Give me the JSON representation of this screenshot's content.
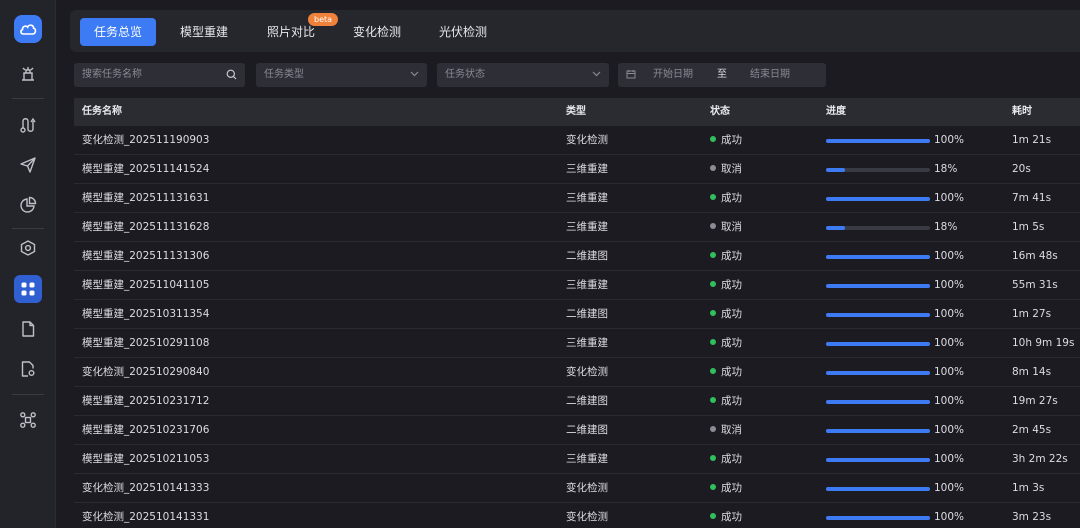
{
  "colors": {
    "accent": "#3d7bf5",
    "success": "#2fbf5b",
    "cancel": "#8c8c96",
    "beta": "#f0813a"
  },
  "sidebar": {
    "logo_icon": "cloud-logo-icon",
    "items": [
      {
        "name": "drone-station-icon"
      },
      {
        "name": "route-icon"
      },
      {
        "name": "send-icon"
      },
      {
        "name": "pie-chart-icon"
      },
      {
        "name": "model-icon"
      },
      {
        "name": "apps-grid-icon",
        "active": true
      },
      {
        "name": "file-icon"
      },
      {
        "name": "file-settings-icon"
      },
      {
        "name": "drone-icon"
      }
    ]
  },
  "tabs": [
    {
      "label": "任务总览",
      "active": true
    },
    {
      "label": "模型重建"
    },
    {
      "label": "照片对比",
      "badge": "beta"
    },
    {
      "label": "变化检测"
    },
    {
      "label": "光伏检测"
    }
  ],
  "filters": {
    "search_placeholder": "搜索任务名称",
    "type_placeholder": "任务类型",
    "status_placeholder": "任务状态",
    "start_date_placeholder": "开始日期",
    "date_separator": "至",
    "end_date_placeholder": "结束日期"
  },
  "table": {
    "headers": {
      "name": "任务名称",
      "type": "类型",
      "status": "状态",
      "progress": "进度",
      "duration": "耗时"
    },
    "rows": [
      {
        "name": "变化检测_202511190903",
        "type": "变化检测",
        "status": "成功",
        "progress": 100,
        "progress_text": "100%",
        "duration": "1m 21s"
      },
      {
        "name": "模型重建_202511141524",
        "type": "三维重建",
        "status": "取消",
        "progress": 18,
        "progress_text": "18%",
        "duration": "20s"
      },
      {
        "name": "模型重建_202511131631",
        "type": "三维重建",
        "status": "成功",
        "progress": 100,
        "progress_text": "100%",
        "duration": "7m 41s"
      },
      {
        "name": "模型重建_202511131628",
        "type": "三维重建",
        "status": "取消",
        "progress": 18,
        "progress_text": "18%",
        "duration": "1m 5s"
      },
      {
        "name": "模型重建_202511131306",
        "type": "二维建图",
        "status": "成功",
        "progress": 100,
        "progress_text": "100%",
        "duration": "16m 48s"
      },
      {
        "name": "模型重建_202511041105",
        "type": "三维重建",
        "status": "成功",
        "progress": 100,
        "progress_text": "100%",
        "duration": "55m 31s"
      },
      {
        "name": "模型重建_202510311354",
        "type": "二维建图",
        "status": "成功",
        "progress": 100,
        "progress_text": "100%",
        "duration": "1m 27s"
      },
      {
        "name": "模型重建_202510291108",
        "type": "三维重建",
        "status": "成功",
        "progress": 100,
        "progress_text": "100%",
        "duration": "10h 9m 19s"
      },
      {
        "name": "变化检测_202510290840",
        "type": "变化检测",
        "status": "成功",
        "progress": 100,
        "progress_text": "100%",
        "duration": "8m 14s"
      },
      {
        "name": "模型重建_202510231712",
        "type": "二维建图",
        "status": "成功",
        "progress": 100,
        "progress_text": "100%",
        "duration": "19m 27s"
      },
      {
        "name": "模型重建_202510231706",
        "type": "二维建图",
        "status": "取消",
        "progress": 100,
        "progress_text": "100%",
        "duration": "2m 45s"
      },
      {
        "name": "模型重建_202510211053",
        "type": "三维重建",
        "status": "成功",
        "progress": 100,
        "progress_text": "100%",
        "duration": "3h 2m 22s"
      },
      {
        "name": "变化检测_202510141333",
        "type": "变化检测",
        "status": "成功",
        "progress": 100,
        "progress_text": "100%",
        "duration": "1m 3s"
      },
      {
        "name": "变化检测_202510141331",
        "type": "变化检测",
        "status": "成功",
        "progress": 100,
        "progress_text": "100%",
        "duration": "3m 23s"
      }
    ]
  }
}
